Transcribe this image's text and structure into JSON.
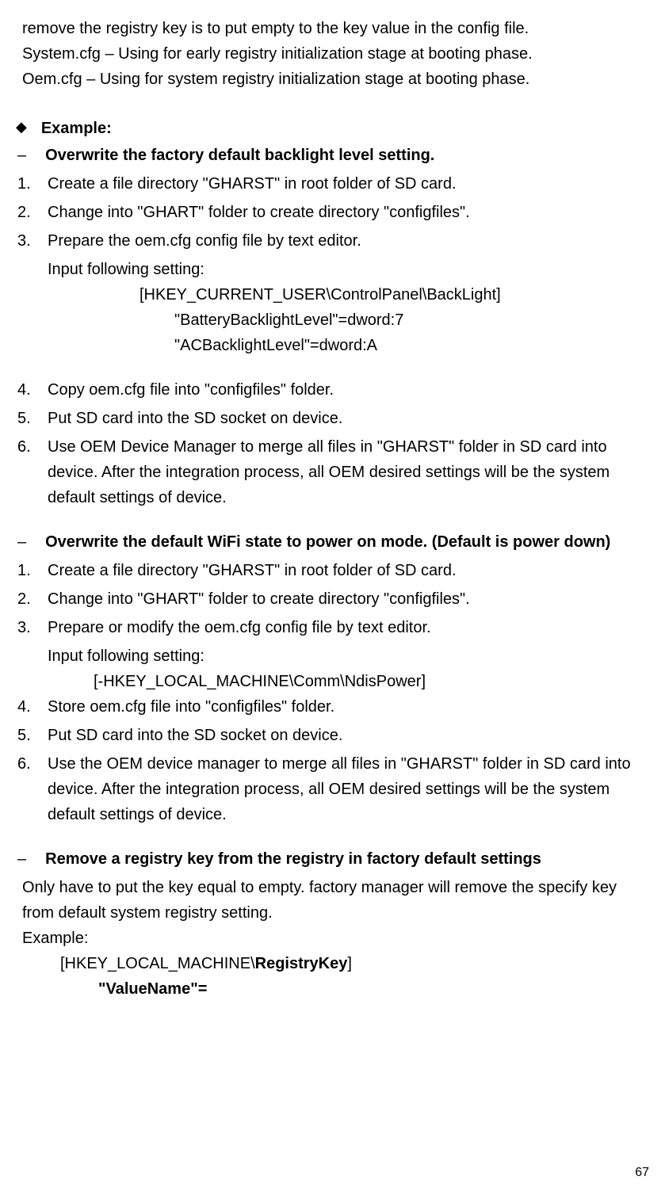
{
  "top": {
    "line1": "remove the registry key is to put empty to the key value in the config file.",
    "line2": "System.cfg – Using for early registry initialization stage at booting phase.",
    "line3": "Oem.cfg – Using for system registry initialization stage at booting phase."
  },
  "example_label": "Example:",
  "section1": {
    "heading": "Overwrite the factory default backlight level setting.",
    "step1": "Create a file directory \"GHARST\" in root folder of SD card.",
    "step2": "Change into \"GHART\" folder to create directory \"configfiles\".",
    "step3": "Prepare the oem.cfg config file by text editor.",
    "step3_sub": "Input following setting:",
    "code1": "[HKEY_CURRENT_USER\\ControlPanel\\BackLight]",
    "code2": "\"BatteryBacklightLevel\"=dword:7",
    "code3": "\"ACBacklightLevel\"=dword:A",
    "step4": "Copy oem.cfg file into \"configfiles\" folder.",
    "step5": "Put SD card into the SD socket on device.",
    "step6": "Use OEM Device Manager to merge all files in \"GHARST\" folder in SD card into device. After the integration process, all OEM desired settings will be the system default settings of device."
  },
  "section2": {
    "heading": "Overwrite the default WiFi state to power on mode. (Default is power down)",
    "step1": "Create a file directory \"GHARST\" in root folder of SD card.",
    "step2": "Change into \"GHART\" folder to create directory \"configfiles\".",
    "step3": "Prepare or modify the oem.cfg config file by text editor.",
    "step3_sub": "Input following setting:",
    "code1": "[-HKEY_LOCAL_MACHINE\\Comm\\NdisPower]",
    "step4": "Store oem.cfg file into \"configfiles\" folder.",
    "step5": "Put SD card into the SD socket on device.",
    "step6": "Use the OEM device manager to merge all files in \"GHARST\" folder in SD card into device. After the integration process, all OEM desired settings will be the system default settings of device."
  },
  "section3": {
    "heading": "Remove a registry key from the registry in factory default settings",
    "text": "Only have to put the key equal to empty. factory manager will remove the specify key from default system registry setting.",
    "example_label": "Example:",
    "code1_prefix": "[HKEY_LOCAL_MACHINE\\",
    "code1_bold": "RegistryKey",
    "code1_suffix": "]",
    "code2": "\"ValueName\"="
  },
  "page_number": "67"
}
